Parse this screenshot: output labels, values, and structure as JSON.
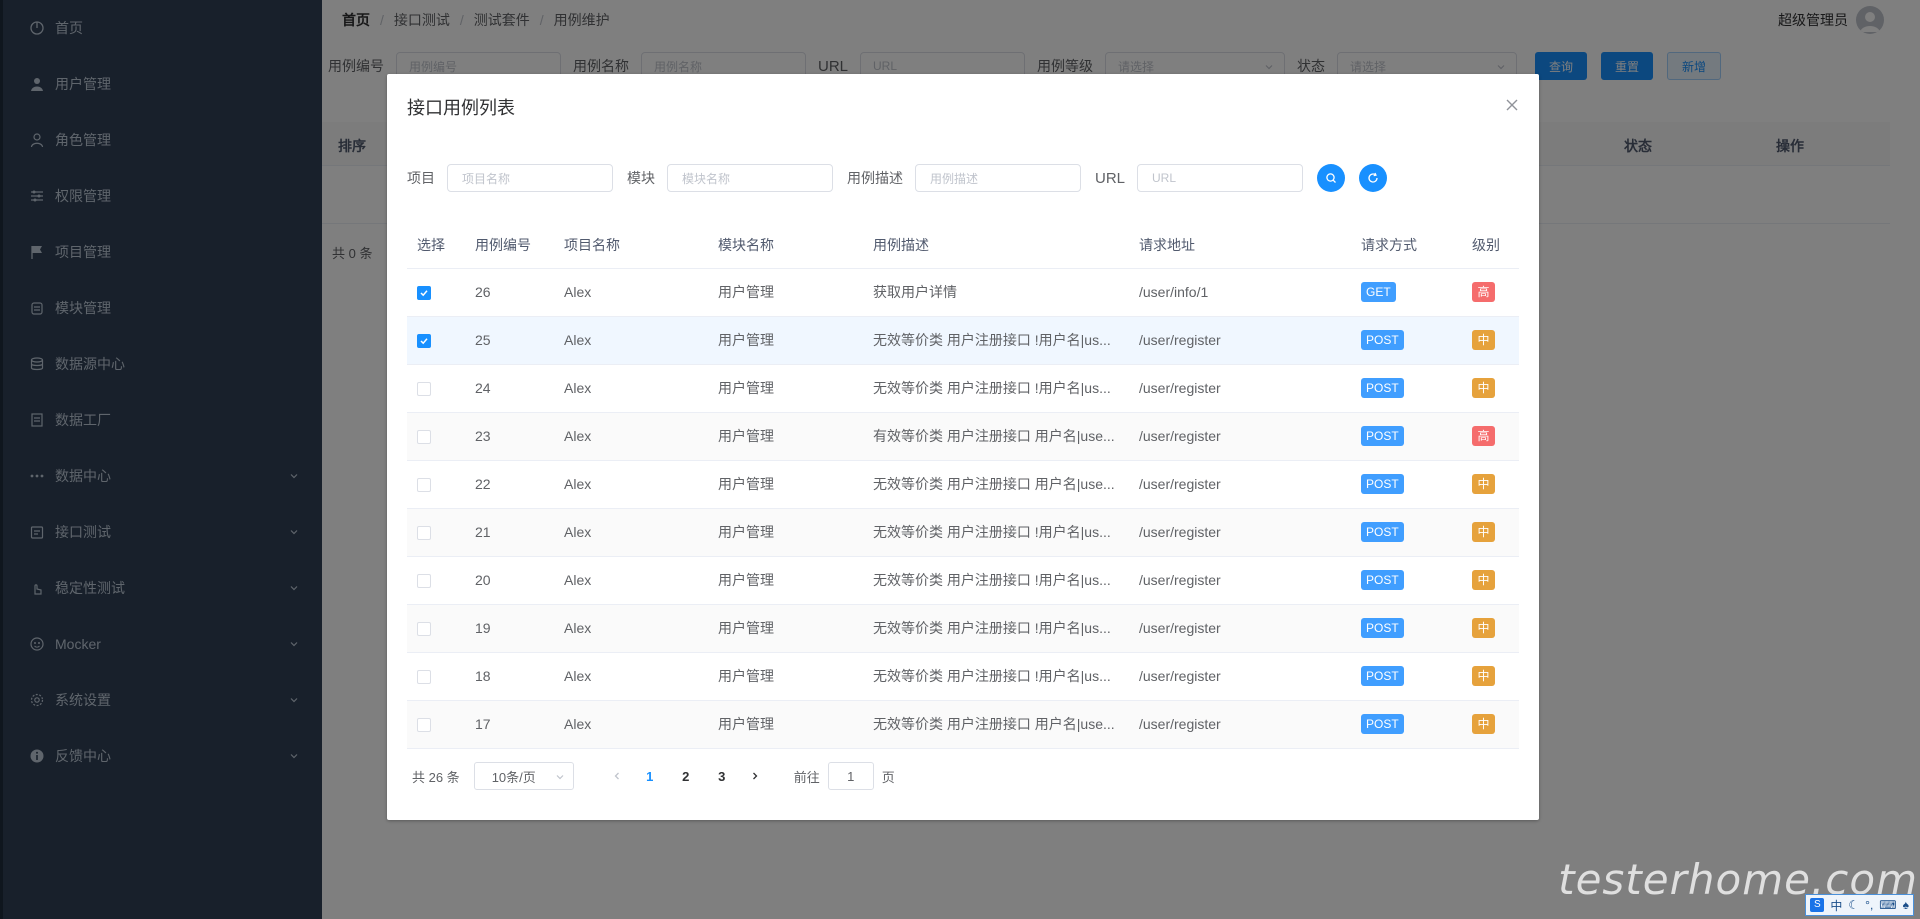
{
  "sidebar": {
    "items": [
      {
        "label": "首页",
        "icon": "dashboard-icon",
        "has_arrow": false
      },
      {
        "label": "用户管理",
        "icon": "user-icon",
        "has_arrow": false
      },
      {
        "label": "角色管理",
        "icon": "peoples-icon",
        "has_arrow": false
      },
      {
        "label": "权限管理",
        "icon": "permission-icon",
        "has_arrow": false
      },
      {
        "label": "项目管理",
        "icon": "flag-icon",
        "has_arrow": false
      },
      {
        "label": "模块管理",
        "icon": "module-icon",
        "has_arrow": false
      },
      {
        "label": "数据源中心",
        "icon": "database-icon",
        "has_arrow": false
      },
      {
        "label": "数据工厂",
        "icon": "document-icon",
        "has_arrow": false
      },
      {
        "label": "数据中心",
        "icon": "more-icon",
        "has_arrow": true
      },
      {
        "label": "接口测试",
        "icon": "api-icon",
        "has_arrow": true
      },
      {
        "label": "稳定性测试",
        "icon": "finger-icon",
        "has_arrow": true
      },
      {
        "label": "Mocker",
        "icon": "mock-icon",
        "has_arrow": true
      },
      {
        "label": "系统设置",
        "icon": "gear-icon",
        "has_arrow": true
      },
      {
        "label": "反馈中心",
        "icon": "info-icon",
        "has_arrow": true
      }
    ]
  },
  "breadcrumb": {
    "items": [
      "首页",
      "接口测试",
      "测试套件",
      "用例维护"
    ],
    "separator": "/"
  },
  "user": {
    "name": "超级管理员"
  },
  "bg_filters": {
    "case_no_label": "用例编号",
    "case_no_placeholder": "用例编号",
    "case_name_label": "用例名称",
    "case_name_placeholder": "用例名称",
    "url_label": "URL",
    "url_placeholder": "URL",
    "level_label": "用例等级",
    "level_placeholder": "请选择",
    "status_label": "状态",
    "status_placeholder": "请选择",
    "query_btn": "查询",
    "reset_btn": "重置",
    "add_btn": "新增"
  },
  "bg_table": {
    "headers": {
      "order": "排序",
      "status": "状态",
      "action": "操作"
    },
    "total": "共 0 条"
  },
  "dialog": {
    "title": "接口用例列表",
    "search": {
      "project_label": "项目",
      "project_placeholder": "项目名称",
      "module_label": "模块",
      "module_placeholder": "模块名称",
      "desc_label": "用例描述",
      "desc_placeholder": "用例描述",
      "url_label": "URL",
      "url_placeholder": "URL"
    },
    "columns": [
      "选择",
      "用例编号",
      "项目名称",
      "模块名称",
      "用例描述",
      "请求地址",
      "请求方式",
      "级别"
    ],
    "rows": [
      {
        "checked": true,
        "id": "26",
        "project": "Alex",
        "module": "用户管理",
        "desc": "获取用户详情",
        "url": "/user/info/1",
        "method": "GET",
        "level": "高"
      },
      {
        "checked": true,
        "id": "25",
        "project": "Alex",
        "module": "用户管理",
        "desc": "无效等价类 用户注册接口 !用户名|us...",
        "url": "/user/register",
        "method": "POST",
        "level": "中"
      },
      {
        "checked": false,
        "id": "24",
        "project": "Alex",
        "module": "用户管理",
        "desc": "无效等价类 用户注册接口 !用户名|us...",
        "url": "/user/register",
        "method": "POST",
        "level": "中"
      },
      {
        "checked": false,
        "id": "23",
        "project": "Alex",
        "module": "用户管理",
        "desc": "有效等价类 用户注册接口 用户名|use...",
        "url": "/user/register",
        "method": "POST",
        "level": "高"
      },
      {
        "checked": false,
        "id": "22",
        "project": "Alex",
        "module": "用户管理",
        "desc": "无效等价类 用户注册接口 用户名|use...",
        "url": "/user/register",
        "method": "POST",
        "level": "中"
      },
      {
        "checked": false,
        "id": "21",
        "project": "Alex",
        "module": "用户管理",
        "desc": "无效等价类 用户注册接口 !用户名|us...",
        "url": "/user/register",
        "method": "POST",
        "level": "中"
      },
      {
        "checked": false,
        "id": "20",
        "project": "Alex",
        "module": "用户管理",
        "desc": "无效等价类 用户注册接口 !用户名|us...",
        "url": "/user/register",
        "method": "POST",
        "level": "中"
      },
      {
        "checked": false,
        "id": "19",
        "project": "Alex",
        "module": "用户管理",
        "desc": "无效等价类 用户注册接口 !用户名|us...",
        "url": "/user/register",
        "method": "POST",
        "level": "中"
      },
      {
        "checked": false,
        "id": "18",
        "project": "Alex",
        "module": "用户管理",
        "desc": "无效等价类 用户注册接口 !用户名|us...",
        "url": "/user/register",
        "method": "POST",
        "level": "中"
      },
      {
        "checked": false,
        "id": "17",
        "project": "Alex",
        "module": "用户管理",
        "desc": "无效等价类 用户注册接口 用户名|use...",
        "url": "/user/register",
        "method": "POST",
        "level": "中"
      }
    ],
    "pagination": {
      "total": "共 26 条",
      "page_size": "10条/页",
      "pages": [
        "1",
        "2",
        "3"
      ],
      "current": "1",
      "goto_label": "前往",
      "goto_value": "1",
      "page_suffix": "页"
    }
  },
  "colors": {
    "sidebar_bg": "#304156",
    "primary": "#1890ff",
    "level_high": "#f56c6c",
    "level_mid": "#e6a23c",
    "method_bg": "#409eff"
  },
  "watermark": "testerhome.com",
  "ime": {
    "mode": "中"
  }
}
